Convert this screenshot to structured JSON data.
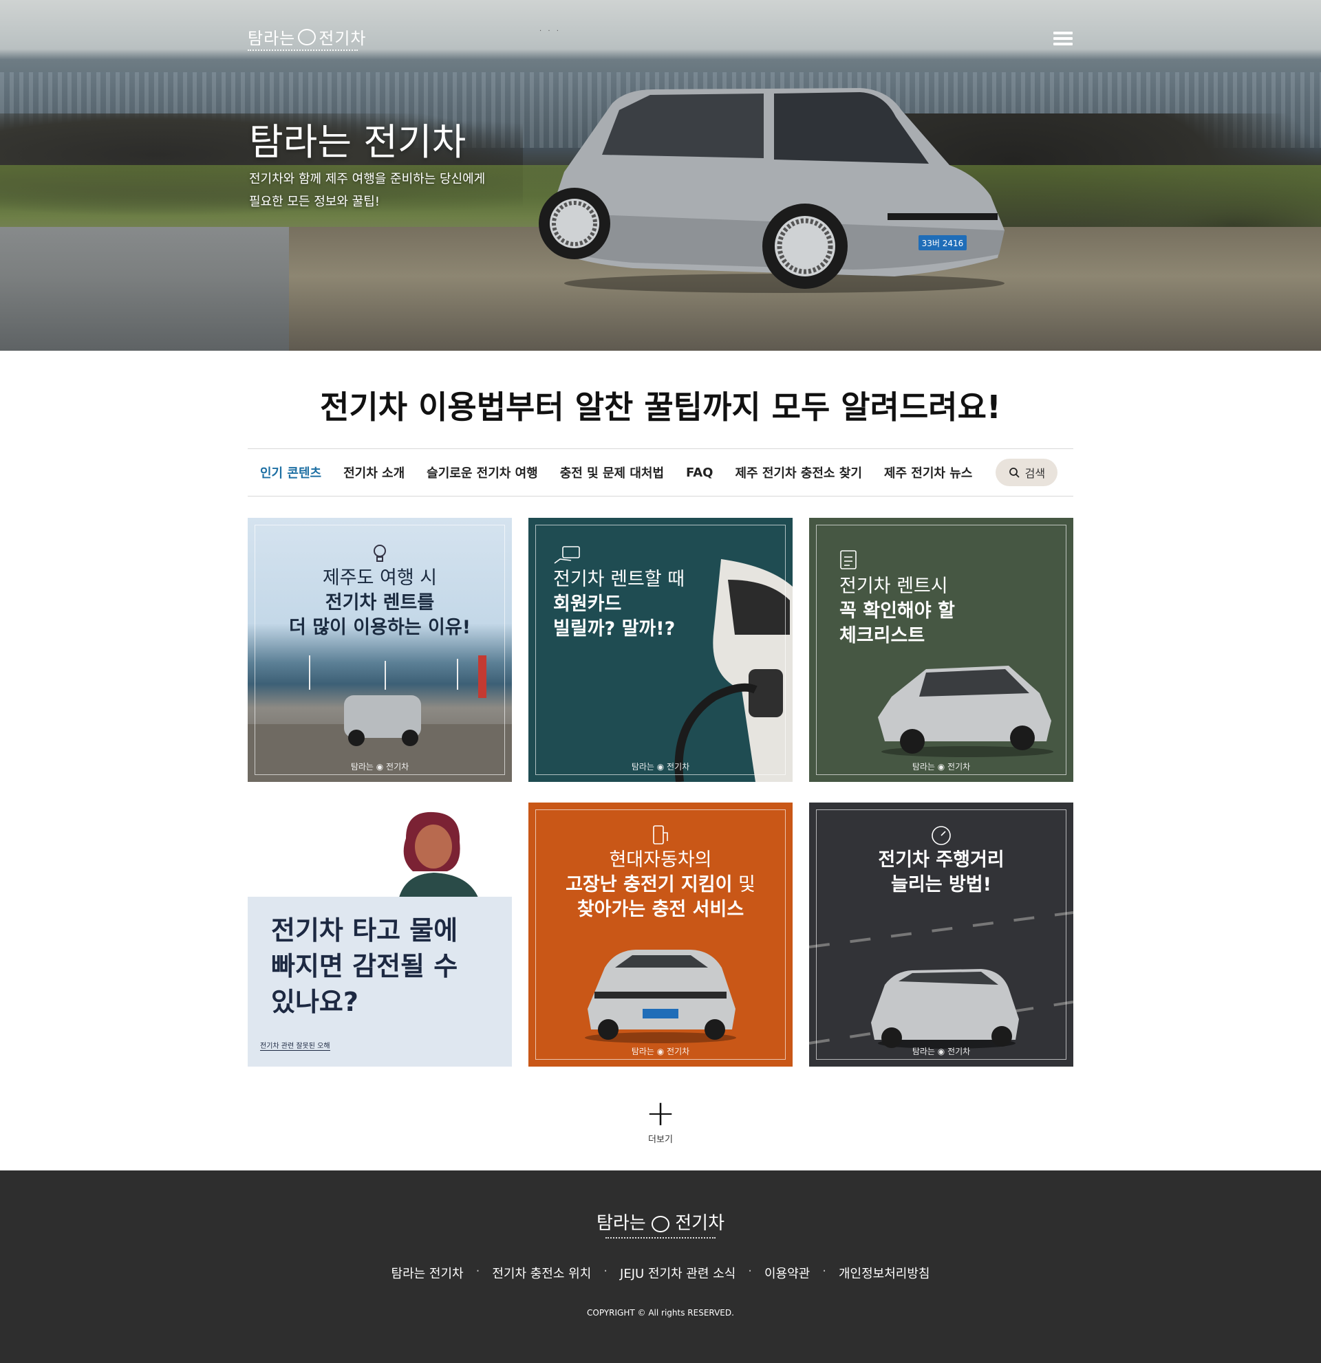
{
  "header": {
    "logo_text_left": "탐라는",
    "logo_text_right": "전기차",
    "dots": "· · ·"
  },
  "hero": {
    "title": "탐라는 전기차",
    "subtitle_line1": "전기차와 함께 제주 여행을 준비하는 당신에게",
    "subtitle_line2": "필요한 모든 정보와 꿀팁!",
    "plate": "33버 2416"
  },
  "headline": "전기차 이용법부터 알찬 꿀팁까지 모두 알려드려요!",
  "nav": {
    "items": [
      "인기 콘텐츠",
      "전기차 소개",
      "슬기로운 전기차 여행",
      "충전 및 문제 대처법",
      "FAQ",
      "제주 전기차 충전소 찾기",
      "제주 전기차 뉴스"
    ],
    "search_label": "검색"
  },
  "cards": [
    {
      "line1": "제주도 여행 시",
      "line2": "전기차 렌트를",
      "line3": "더 많이 이용하는 이유!",
      "icon": "lightbulb-icon"
    },
    {
      "line1": "전기차 렌트할 때",
      "line2": "회원카드",
      "line3": "빌릴까? 말까!?",
      "icon": "card-icon"
    },
    {
      "line1": "전기차 렌트시",
      "line2": "꼭 확인해야 할",
      "line3": "체크리스트",
      "icon": "checklist-icon"
    },
    {
      "line1": "전기차 타고 물에",
      "line2": "빠지면 감전될 수",
      "line3": "있나요?",
      "caption": "전기차 관련 잘못된 오해"
    },
    {
      "line1": "현대자동차의",
      "line2a": "고장난 충전기 지킴이",
      "line2b": " 및",
      "line3": "찾아가는 충전 서비스",
      "icon": "charger-icon"
    },
    {
      "line1": "전기차 주행거리",
      "line2": "늘리는 방법!",
      "icon": "gauge-icon"
    }
  ],
  "card_logo": "탐라는 ◉ 전기차",
  "more": {
    "label": "더보기",
    "symbol": "+"
  },
  "footer": {
    "logo_left": "탐라는",
    "logo_right": "전기차",
    "links": [
      "탐라는 전기차",
      "전기차 충전소 위치",
      "JEJU 전기차 관련 소식",
      "이용약관",
      "개인정보처리방침"
    ],
    "separator": "·",
    "copyright": "COPYRIGHT © All rights RESERVED."
  },
  "colors": {
    "accent_nav": "#1d6fa3",
    "footer_bg": "#2e2e2e",
    "card_teal": "#1f4c52",
    "card_green": "#465743",
    "card_orange": "#c95717",
    "card_dark": "#323337",
    "search_bg": "#e9e3dc"
  }
}
